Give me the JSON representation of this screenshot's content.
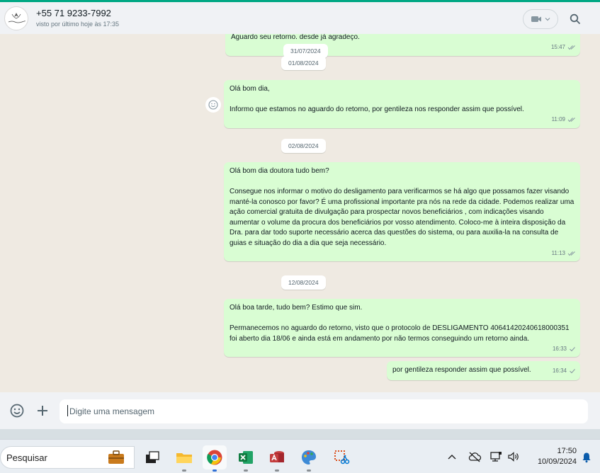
{
  "header": {
    "contact_name": "+55 71 9233-7992",
    "last_seen": "visto por último hoje às 17:35"
  },
  "chat": {
    "partial_top": {
      "text": "Aguardo seu retorno. desde já agradeço.",
      "time": "15:47"
    },
    "dates": [
      "31/07/2024",
      "01/08/2024",
      "02/08/2024",
      "12/08/2024"
    ],
    "messages": [
      {
        "text": "Olá bom dia,\n\nInformo que estamos no aguardo do retorno, por gentileza nos responder assim que possível.",
        "time": "11:09"
      },
      {
        "text": "Olá bom dia doutora tudo bem?\n\nConsegue nos informar o motivo do desligamento para verificarmos se há algo que possamos fazer visando manté-la conosco por favor? É uma profissional importante pra nós na rede da cidade. Podemos realizar uma ação comercial gratuita de divulgação para prospectar novos beneficiários , com indicações visando aumentar o volume da procura dos beneficiários por vosso atendimento. Coloco-me à inteira disposição da Dra. para dar todo suporte necessário acerca das questões do sistema, ou para auxilia-la na consulta de guias e situação do dia a dia que seja necessário.",
        "time": "11:13"
      },
      {
        "text": "Olá boa tarde, tudo bem? Estimo que sim.\n\nPermanecemos no aguardo do retorno, visto que o protocolo de DESLIGAMENTO 40641420240618000351 foi aberto dia 18/06 e ainda está em andamento por não termos conseguindo um retorno ainda.",
        "time": "16:33"
      },
      {
        "text": "por gentileza responder assim que possível.",
        "time": "16:34"
      }
    ]
  },
  "composer": {
    "placeholder": "Digite uma mensagem"
  },
  "taskbar": {
    "search_label": "Pesquisar",
    "time": "17:50",
    "date": "10/09/2024"
  },
  "icons": {
    "read_ticks_color": "#53bdeb",
    "delivered_ticks_color": "#8696a0",
    "accent": "#00a884"
  }
}
